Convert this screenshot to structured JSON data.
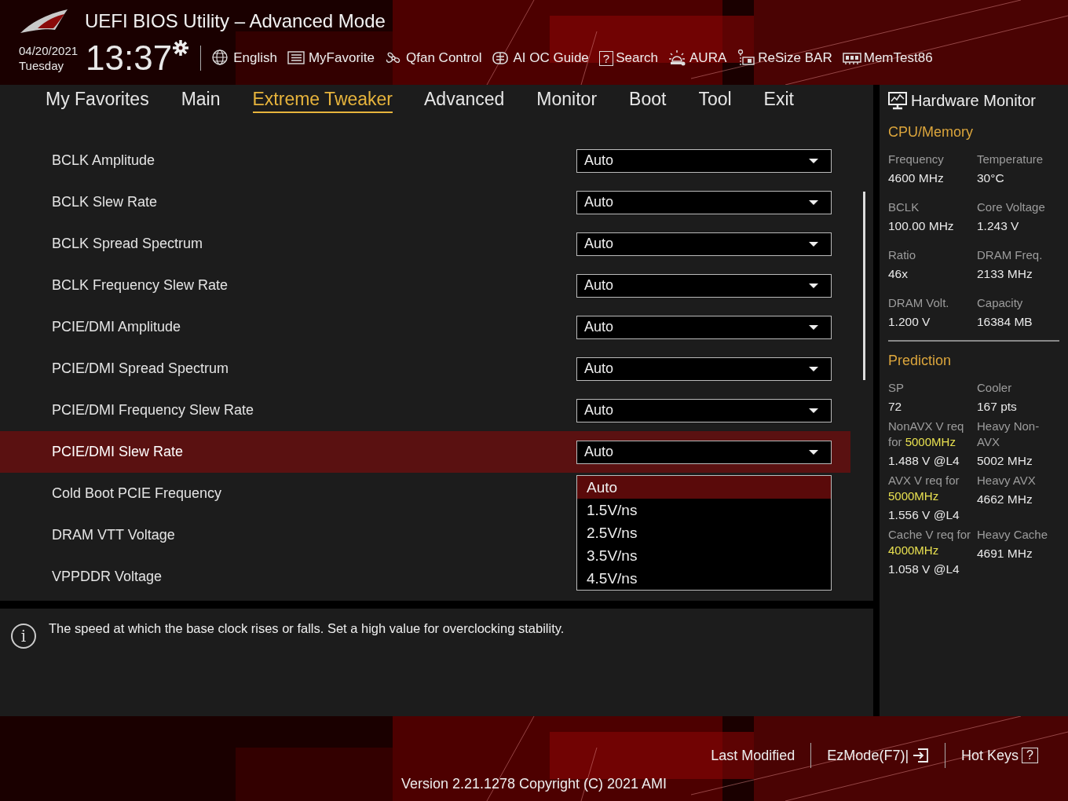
{
  "header": {
    "title": "UEFI BIOS Utility – Advanced Mode",
    "date": "04/20/2021",
    "day": "Tuesday",
    "time": "13:37",
    "tools": [
      {
        "label": "English"
      },
      {
        "label": "MyFavorite"
      },
      {
        "label": "Qfan Control"
      },
      {
        "label": "AI OC Guide"
      },
      {
        "label": "Search",
        "glyph": "?"
      },
      {
        "label": "AURA"
      },
      {
        "label": "ReSize BAR"
      },
      {
        "label": "MemTest86"
      }
    ]
  },
  "tabs": [
    {
      "label": "My Favorites",
      "selected": false
    },
    {
      "label": "Main",
      "selected": false
    },
    {
      "label": "Extreme Tweaker",
      "selected": true
    },
    {
      "label": "Advanced",
      "selected": false
    },
    {
      "label": "Monitor",
      "selected": false
    },
    {
      "label": "Boot",
      "selected": false
    },
    {
      "label": "Tool",
      "selected": false
    },
    {
      "label": "Exit",
      "selected": false
    }
  ],
  "settings": [
    {
      "label": "BCLK Amplitude",
      "value": "Auto",
      "selected": false
    },
    {
      "label": "BCLK Slew Rate",
      "value": "Auto",
      "selected": false
    },
    {
      "label": "BCLK Spread Spectrum",
      "value": "Auto",
      "selected": false
    },
    {
      "label": "BCLK Frequency Slew Rate",
      "value": "Auto",
      "selected": false
    },
    {
      "label": "PCIE/DMI Amplitude",
      "value": "Auto",
      "selected": false
    },
    {
      "label": "PCIE/DMI Spread Spectrum",
      "value": "Auto",
      "selected": false
    },
    {
      "label": "PCIE/DMI Frequency Slew Rate",
      "value": "Auto",
      "selected": false
    },
    {
      "label": "PCIE/DMI Slew Rate",
      "value": "Auto",
      "selected": true,
      "options": [
        {
          "label": "Auto",
          "selected": true
        },
        {
          "label": "1.5V/ns",
          "selected": false
        },
        {
          "label": "2.5V/ns",
          "selected": false
        },
        {
          "label": "3.5V/ns",
          "selected": false
        },
        {
          "label": "4.5V/ns",
          "selected": false
        }
      ]
    },
    {
      "label": "Cold Boot PCIE Frequency",
      "selected": false
    },
    {
      "label": "DRAM VTT Voltage",
      "selected": false
    },
    {
      "label": "VPPDDR Voltage",
      "selected": false
    }
  ],
  "help": {
    "glyph": "i",
    "text": "The speed at which the base clock rises or falls. Set a high value for overclocking stability."
  },
  "hardware_monitor": {
    "title": "Hardware Monitor",
    "sections": [
      {
        "title": "CPU/Memory",
        "items": [
          {
            "label": "Frequency",
            "value": "4600 MHz"
          },
          {
            "label": "Temperature",
            "value": "30°C"
          },
          {
            "label": "BCLK",
            "value": "100.00 MHz"
          },
          {
            "label": "Core Voltage",
            "value": "1.243 V"
          },
          {
            "label": "Ratio",
            "value": "46x"
          },
          {
            "label": "DRAM Freq.",
            "value": "2133 MHz"
          },
          {
            "label": "DRAM Volt.",
            "value": "1.200 V"
          },
          {
            "label": "Capacity",
            "value": "16384 MB"
          }
        ]
      },
      {
        "title": "Prediction",
        "items": [
          {
            "label": "SP",
            "value": "72"
          },
          {
            "label": "Cooler",
            "value": "167 pts"
          },
          {
            "label": "NonAVX V req for **5000MHz**",
            "value": "1.488 V @L4"
          },
          {
            "label": "Heavy Non-AVX",
            "value": "5002 MHz"
          },
          {
            "label": "AVX V req for **5000MHz**",
            "value": "1.556 V @L4"
          },
          {
            "label": "Heavy AVX",
            "value": "4662 MHz"
          },
          {
            "label": "Cache V req for **4000MHz**",
            "value": "1.058 V @L4"
          },
          {
            "label": "Heavy Cache",
            "value": "4691 MHz"
          }
        ]
      }
    ]
  },
  "footer": {
    "buttons": [
      {
        "label": "Last Modified"
      },
      {
        "label": "EzMode(F7)|",
        "icon": true
      },
      {
        "label": "Hot Keys",
        "glyph": "?"
      }
    ],
    "version": "Version 2.21.1278 Copyright (C) 2021 AMI"
  }
}
